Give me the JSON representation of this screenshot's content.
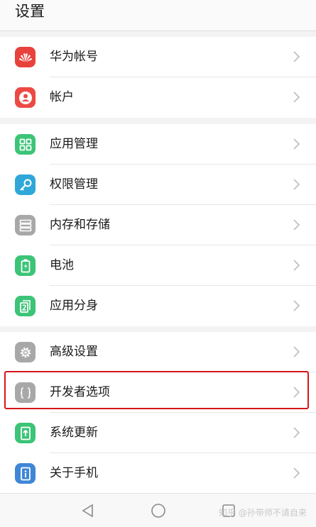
{
  "header": {
    "title": "设置"
  },
  "groups": [
    {
      "items": [
        {
          "label": "华为帐号",
          "icon": "huawei-logo-icon",
          "color": "#e8423c"
        },
        {
          "label": "帐户",
          "icon": "user-account-icon",
          "color": "#ec4a44"
        }
      ]
    },
    {
      "items": [
        {
          "label": "应用管理",
          "icon": "apps-grid-icon",
          "color": "#3cc477"
        },
        {
          "label": "权限管理",
          "icon": "key-icon",
          "color": "#2fa8d8"
        },
        {
          "label": "内存和存储",
          "icon": "storage-icon",
          "color": "#a8a8a8"
        },
        {
          "label": "电池",
          "icon": "battery-icon",
          "color": "#3cc477"
        },
        {
          "label": "应用分身",
          "icon": "app-twin-icon",
          "color": "#3cc477"
        }
      ]
    },
    {
      "items": [
        {
          "label": "高级设置",
          "icon": "gear-icon",
          "color": "#a8a8a8"
        },
        {
          "label": "开发者选项",
          "icon": "developer-braces-icon",
          "color": "#a8a8a8"
        },
        {
          "label": "系统更新",
          "icon": "system-update-icon",
          "color": "#3cc477"
        },
        {
          "label": "关于手机",
          "icon": "info-icon",
          "color": "#3f86d6"
        }
      ]
    }
  ],
  "watermark": "知乎 @孙带师不请自来",
  "accent": {
    "highlight": "#d6161a"
  }
}
